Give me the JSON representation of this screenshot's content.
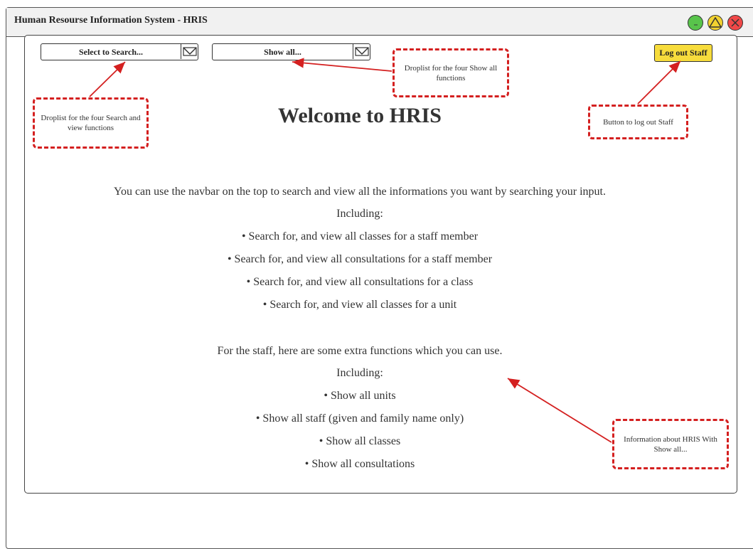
{
  "window": {
    "title": "Human Resourse Information System - HRIS"
  },
  "navbar": {
    "search_dropdown": "Select to Search...",
    "show_dropdown": "Show all...",
    "logout_button": "Log out Staff"
  },
  "annotations": {
    "search_note": "Droplist for the four Search and view functions",
    "show_note": "Droplist for the four Show all functions",
    "logout_note": "Button to log out Staff",
    "info_note": "Information about HRIS With Show all..."
  },
  "main": {
    "heading": "Welcome to HRIS",
    "intro": "You can use the navbar on the top to search and view all the informations you want by searching your input.",
    "including_1": "Including:",
    "search_items": [
      "• Search for, and view all classes for a staff member",
      "• Search for, and view all consultations for a staff member",
      "• Search for, and view all consultations for a class",
      "• Search for, and view all classes for a unit"
    ],
    "staff_intro": "For the staff, here are some extra functions which you can use.",
    "including_2": "Including:",
    "show_items": [
      "• Show all units",
      "• Show all staff (given and family name only)",
      "• Show all classes",
      "• Show all consultations"
    ]
  },
  "colors": {
    "annotation": "#d42020",
    "logout": "#f7dc3c",
    "minimize": "#58c44b",
    "maximize": "#f2d230",
    "close": "#f04848"
  }
}
